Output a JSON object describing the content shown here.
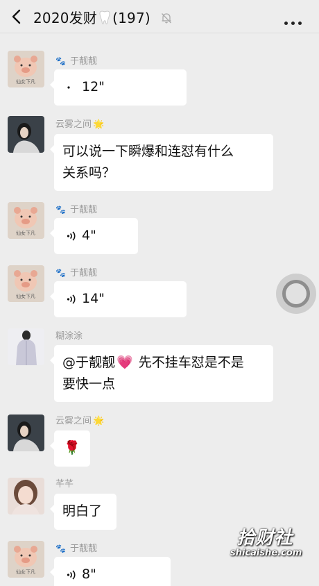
{
  "header": {
    "title": "2020发财",
    "member_count": "(197)",
    "icons": [
      "back-arrow-icon",
      "tooth-emoji-icon",
      "mute-bell-icon",
      "more-icon"
    ]
  },
  "messages": [
    {
      "sender": "于靓靓",
      "type": "voice",
      "text": "12\"",
      "avatar": "pig-avatar",
      "avatar_caption": "仙女下凡"
    },
    {
      "sender": "云雾之间",
      "type": "text",
      "lines": [
        "可以说一下瞬爆和连怼有什么",
        "关系吗？"
      ],
      "avatar": "girl-photo-avatar"
    },
    {
      "sender": "于靓靓",
      "type": "voice",
      "text": "4\"",
      "avatar": "pig-avatar",
      "avatar_caption": "仙女下凡"
    },
    {
      "sender": "于靓靓",
      "type": "voice",
      "text": "14\"",
      "avatar": "pig-avatar",
      "avatar_caption": "仙女下凡"
    },
    {
      "sender": "糊涂涂",
      "type": "text",
      "lines": [
        "@于靓靓",
        "先不挂车怼是不是",
        "要快一点"
      ],
      "avatar": "man-photo-avatar"
    },
    {
      "sender": "云雾之间",
      "type": "emoji",
      "emoji": "🌹",
      "avatar": "girl-photo-avatar"
    },
    {
      "sender": "芊芊",
      "type": "text",
      "lines": [
        "明白了"
      ],
      "avatar": "woman-photo-avatar"
    },
    {
      "sender": "于靓靓",
      "type": "voice",
      "text": "8\"",
      "avatar": "pig-avatar",
      "avatar_caption": "仙女下凡"
    }
  ],
  "watermark": {
    "main": "拾财社",
    "sub": "shicaishe.com"
  },
  "colors": {
    "background": "#ededed",
    "bubble": "#ffffff",
    "sender_name": "#9a9a9a"
  }
}
